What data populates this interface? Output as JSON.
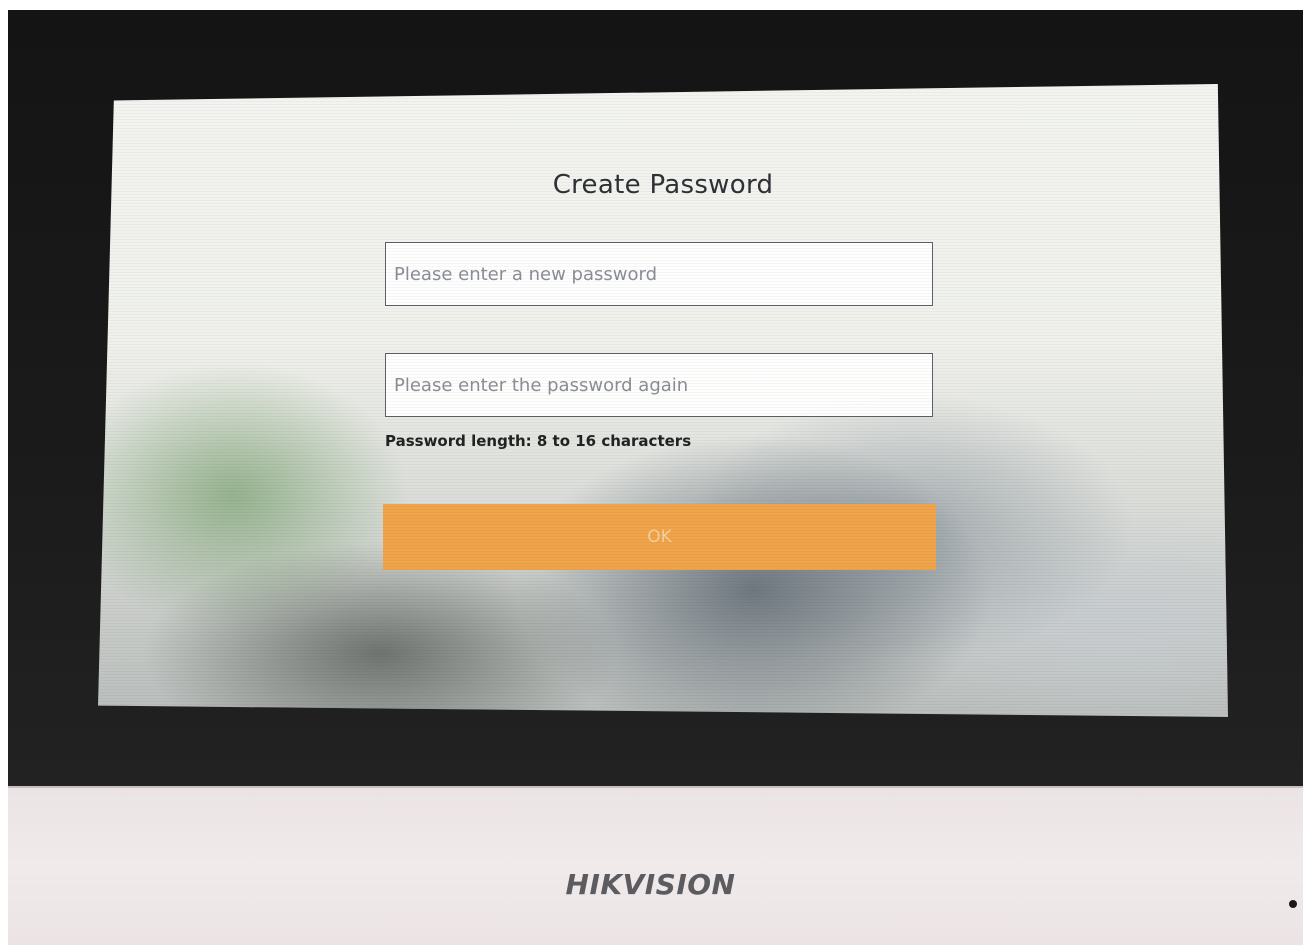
{
  "screen": {
    "title": "Create Password",
    "new_password": {
      "value": "",
      "placeholder": "Please enter a new password"
    },
    "confirm_password": {
      "value": "",
      "placeholder": "Please enter the password again"
    },
    "hint": "Password length: 8 to 16 characters",
    "ok_label": "OK"
  },
  "device": {
    "brand": "HIKVISION"
  },
  "colors": {
    "accent": "#f0a449",
    "bezel": "#1b1b1b",
    "housing": "#eee8e8"
  }
}
